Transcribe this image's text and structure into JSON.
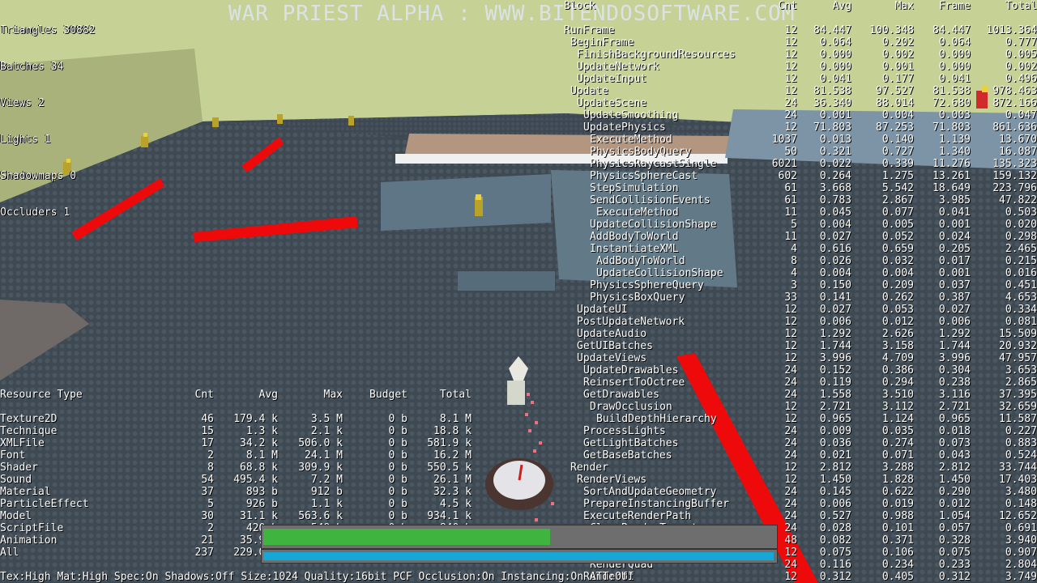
{
  "banner": "WAR PRIEST ALPHA : WWW.BITENDOSOFTWARE.COM",
  "stats": [
    "Triangles 30882",
    "Batches 34",
    "Views 2",
    "Lights 1",
    "Shadowmaps 0",
    "Occluders 1"
  ],
  "profiler": {
    "headers": [
      "Block",
      "Cnt",
      "Avg",
      "Max",
      "Frame",
      "Total"
    ],
    "rows": [
      {
        "name": "RunFrame",
        "indent": 0,
        "cnt": "12",
        "avg": "84.447",
        "max": "100.348",
        "frame": "84.447",
        "total": "1013.364"
      },
      {
        "name": "BeginFrame",
        "indent": 1,
        "cnt": "12",
        "avg": "0.064",
        "max": "0.202",
        "frame": "0.064",
        "total": "0.777"
      },
      {
        "name": "FinishBackgroundResources",
        "indent": 2,
        "cnt": "12",
        "avg": "0.000",
        "max": "0.002",
        "frame": "0.000",
        "total": "0.005"
      },
      {
        "name": "UpdateNetwork",
        "indent": 2,
        "cnt": "12",
        "avg": "0.000",
        "max": "0.001",
        "frame": "0.000",
        "total": "0.002"
      },
      {
        "name": "UpdateInput",
        "indent": 2,
        "cnt": "12",
        "avg": "0.041",
        "max": "0.177",
        "frame": "0.041",
        "total": "0.496"
      },
      {
        "name": "Update",
        "indent": 1,
        "cnt": "12",
        "avg": "81.538",
        "max": "97.527",
        "frame": "81.538",
        "total": "978.463"
      },
      {
        "name": "UpdateScene",
        "indent": 2,
        "cnt": "24",
        "avg": "36.340",
        "max": "88.014",
        "frame": "72.680",
        "total": "872.166"
      },
      {
        "name": "UpdateSmoothing",
        "indent": 3,
        "cnt": "24",
        "avg": "0.001",
        "max": "0.004",
        "frame": "0.003",
        "total": "0.047"
      },
      {
        "name": "UpdatePhysics",
        "indent": 3,
        "cnt": "12",
        "avg": "71.803",
        "max": "87.253",
        "frame": "71.803",
        "total": "861.636"
      },
      {
        "name": "ExecuteMethod",
        "indent": 4,
        "cnt": "1037",
        "avg": "0.013",
        "max": "0.140",
        "frame": "1.139",
        "total": "13.670"
      },
      {
        "name": "PhysicsBodyQuery",
        "indent": 4,
        "cnt": "50",
        "avg": "0.321",
        "max": "0.727",
        "frame": "1.340",
        "total": "16.087"
      },
      {
        "name": "PhysicsRaycastSingle",
        "indent": 4,
        "cnt": "6021",
        "avg": "0.022",
        "max": "0.339",
        "frame": "11.276",
        "total": "135.323"
      },
      {
        "name": "PhysicsSphereCast",
        "indent": 4,
        "cnt": "602",
        "avg": "0.264",
        "max": "1.275",
        "frame": "13.261",
        "total": "159.132"
      },
      {
        "name": "StepSimulation",
        "indent": 4,
        "cnt": "61",
        "avg": "3.668",
        "max": "5.542",
        "frame": "18.649",
        "total": "223.796"
      },
      {
        "name": "SendCollisionEvents",
        "indent": 4,
        "cnt": "61",
        "avg": "0.783",
        "max": "2.867",
        "frame": "3.985",
        "total": "47.822"
      },
      {
        "name": "ExecuteMethod",
        "indent": 5,
        "cnt": "11",
        "avg": "0.045",
        "max": "0.077",
        "frame": "0.041",
        "total": "0.503"
      },
      {
        "name": "UpdateCollisionShape",
        "indent": 4,
        "cnt": "5",
        "avg": "0.004",
        "max": "0.005",
        "frame": "0.001",
        "total": "0.020"
      },
      {
        "name": "AddBodyToWorld",
        "indent": 4,
        "cnt": "11",
        "avg": "0.027",
        "max": "0.052",
        "frame": "0.024",
        "total": "0.298"
      },
      {
        "name": "InstantiateXML",
        "indent": 4,
        "cnt": "4",
        "avg": "0.616",
        "max": "0.659",
        "frame": "0.205",
        "total": "2.465"
      },
      {
        "name": "AddBodyToWorld",
        "indent": 5,
        "cnt": "8",
        "avg": "0.026",
        "max": "0.032",
        "frame": "0.017",
        "total": "0.215"
      },
      {
        "name": "UpdateCollisionShape",
        "indent": 5,
        "cnt": "4",
        "avg": "0.004",
        "max": "0.004",
        "frame": "0.001",
        "total": "0.016"
      },
      {
        "name": "PhysicsSphereQuery",
        "indent": 4,
        "cnt": "3",
        "avg": "0.150",
        "max": "0.209",
        "frame": "0.037",
        "total": "0.451"
      },
      {
        "name": "PhysicsBoxQuery",
        "indent": 4,
        "cnt": "33",
        "avg": "0.141",
        "max": "0.262",
        "frame": "0.387",
        "total": "4.653"
      },
      {
        "name": "UpdateUI",
        "indent": 2,
        "cnt": "12",
        "avg": "0.027",
        "max": "0.053",
        "frame": "0.027",
        "total": "0.334"
      },
      {
        "name": "PostUpdateNetwork",
        "indent": 2,
        "cnt": "12",
        "avg": "0.006",
        "max": "0.012",
        "frame": "0.006",
        "total": "0.081"
      },
      {
        "name": "UpdateAudio",
        "indent": 2,
        "cnt": "12",
        "avg": "1.292",
        "max": "2.626",
        "frame": "1.292",
        "total": "15.509"
      },
      {
        "name": "GetUIBatches",
        "indent": 2,
        "cnt": "12",
        "avg": "1.744",
        "max": "3.158",
        "frame": "1.744",
        "total": "20.932"
      },
      {
        "name": "UpdateViews",
        "indent": 2,
        "cnt": "12",
        "avg": "3.996",
        "max": "4.709",
        "frame": "3.996",
        "total": "47.957"
      },
      {
        "name": "UpdateDrawables",
        "indent": 3,
        "cnt": "24",
        "avg": "0.152",
        "max": "0.386",
        "frame": "0.304",
        "total": "3.653"
      },
      {
        "name": "ReinsertToOctree",
        "indent": 3,
        "cnt": "24",
        "avg": "0.119",
        "max": "0.294",
        "frame": "0.238",
        "total": "2.865"
      },
      {
        "name": "GetDrawables",
        "indent": 3,
        "cnt": "24",
        "avg": "1.558",
        "max": "3.510",
        "frame": "3.116",
        "total": "37.395"
      },
      {
        "name": "DrawOcclusion",
        "indent": 4,
        "cnt": "12",
        "avg": "2.721",
        "max": "3.112",
        "frame": "2.721",
        "total": "32.659"
      },
      {
        "name": "BuildDepthHierarchy",
        "indent": 5,
        "cnt": "12",
        "avg": "0.965",
        "max": "1.124",
        "frame": "0.965",
        "total": "11.587"
      },
      {
        "name": "ProcessLights",
        "indent": 3,
        "cnt": "24",
        "avg": "0.009",
        "max": "0.035",
        "frame": "0.018",
        "total": "0.227"
      },
      {
        "name": "GetLightBatches",
        "indent": 3,
        "cnt": "24",
        "avg": "0.036",
        "max": "0.274",
        "frame": "0.073",
        "total": "0.883"
      },
      {
        "name": "GetBaseBatches",
        "indent": 3,
        "cnt": "24",
        "avg": "0.021",
        "max": "0.071",
        "frame": "0.043",
        "total": "0.524"
      },
      {
        "name": "Render",
        "indent": 1,
        "cnt": "12",
        "avg": "2.812",
        "max": "3.288",
        "frame": "2.812",
        "total": "33.744"
      },
      {
        "name": "RenderViews",
        "indent": 2,
        "cnt": "12",
        "avg": "1.450",
        "max": "1.828",
        "frame": "1.450",
        "total": "17.403"
      },
      {
        "name": "SortAndUpdateGeometry",
        "indent": 3,
        "cnt": "24",
        "avg": "0.145",
        "max": "0.622",
        "frame": "0.290",
        "total": "3.480"
      },
      {
        "name": "PrepareInstancingBuffer",
        "indent": 3,
        "cnt": "24",
        "avg": "0.006",
        "max": "0.019",
        "frame": "0.012",
        "total": "0.148"
      },
      {
        "name": "ExecuteRenderPath",
        "indent": 3,
        "cnt": "24",
        "avg": "0.527",
        "max": "0.988",
        "frame": "1.054",
        "total": "12.652"
      },
      {
        "name": "ClearRenderTarget",
        "indent": 4,
        "cnt": "24",
        "avg": "0.028",
        "max": "0.101",
        "frame": "0.057",
        "total": "0.691"
      },
      {
        "name": "RenderScenePass",
        "indent": 4,
        "cnt": "48",
        "avg": "0.082",
        "max": "0.371",
        "frame": "0.328",
        "total": "3.940"
      },
      {
        "name": "BlitFramebuffer",
        "indent": 4,
        "cnt": "12",
        "avg": "0.075",
        "max": "0.106",
        "frame": "0.075",
        "total": "0.907"
      },
      {
        "name": "RenderQuad",
        "indent": 4,
        "cnt": "24",
        "avg": "0.116",
        "max": "0.234",
        "frame": "0.233",
        "total": "2.804"
      },
      {
        "name": "RenderUI",
        "indent": 3,
        "cnt": "12",
        "avg": "0.312",
        "max": "0.405",
        "frame": "0.312",
        "total": "3.749"
      }
    ]
  },
  "resources": {
    "headers": [
      "Resource Type",
      "Cnt",
      "Avg",
      "Max",
      "Budget",
      "Total"
    ],
    "rows": [
      {
        "type": "Texture2D",
        "cnt": "46",
        "avg": "179.4 k",
        "max": "3.5 M",
        "budget": "0 b",
        "total": "8.1 M"
      },
      {
        "type": "Technique",
        "cnt": "15",
        "avg": "1.3 k",
        "max": "2.1 k",
        "budget": "0 b",
        "total": "18.8 k"
      },
      {
        "type": "XMLFile",
        "cnt": "17",
        "avg": "34.2 k",
        "max": "506.0 k",
        "budget": "0 b",
        "total": "581.9 k"
      },
      {
        "type": "Font",
        "cnt": "2",
        "avg": "8.1 M",
        "max": "24.1 M",
        "budget": "0 b",
        "total": "16.2 M"
      },
      {
        "type": "Shader",
        "cnt": "8",
        "avg": "68.8 k",
        "max": "309.9 k",
        "budget": "0 b",
        "total": "550.5 k"
      },
      {
        "type": "Sound",
        "cnt": "54",
        "avg": "495.4 k",
        "max": "7.2 M",
        "budget": "0 b",
        "total": "26.1 M"
      },
      {
        "type": "Material",
        "cnt": "37",
        "avg": "893 b",
        "max": "912 b",
        "budget": "0 b",
        "total": "32.3 k"
      },
      {
        "type": "ParticleEffect",
        "cnt": "5",
        "avg": "926 b",
        "max": "1.1 k",
        "budget": "0 b",
        "total": "4.5 k"
      },
      {
        "type": "Model",
        "cnt": "30",
        "avg": "31.1 k",
        "max": "563.6 k",
        "budget": "0 b",
        "total": "934.1 k"
      },
      {
        "type": "ScriptFile",
        "cnt": "2",
        "avg": "420 b",
        "max": "549 b",
        "budget": "0 b",
        "total": "840 b"
      },
      {
        "type": "Animation",
        "cnt": "21",
        "avg": "35.9 k",
        "max": "134.8 k",
        "budget": "0 b",
        "total": "753.4 k"
      },
      {
        "type": "All",
        "cnt": "237",
        "avg": "229.0 k",
        "max": "24.1 M",
        "budget": "-",
        "total": "53.2 M"
      }
    ]
  },
  "hud": {
    "health_fraction": 0.56,
    "mana_fraction": 1.0,
    "health_color": "#3fb53f",
    "mana_color": "#17a7d6"
  },
  "bottom_status": "Tex:High Mat:High Spec:On Shadows:Off Size:1024 Quality:16bit PCF Occlusion:On Instancing:On ATT:Off",
  "colors": {
    "sky": "#c6d196",
    "floor": "#3b4650",
    "red_beam": "#ee0a0a"
  }
}
